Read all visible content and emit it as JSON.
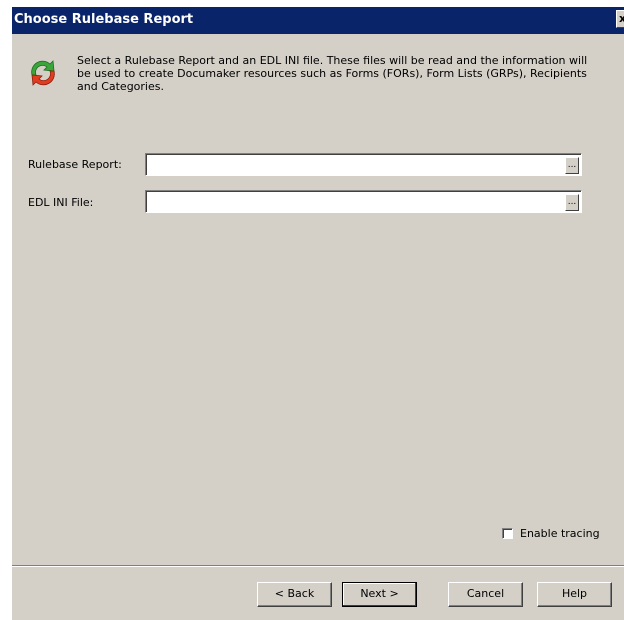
{
  "window": {
    "title": "Choose Rulebase Report",
    "close_glyph": "x"
  },
  "header": {
    "icon": "refresh-arrows-icon",
    "description": "Select a Rulebase Report and an EDL INI file. These files will be read and the information will be used to create Documaker resources such as Forms (FORs), Form Lists (GRPs), Recipients and Categories."
  },
  "fields": {
    "rulebase_report": {
      "label": "Rulebase Report:",
      "value": "",
      "browse_label": "..."
    },
    "edl_ini_file": {
      "label": "EDL INI File:",
      "value": "",
      "browse_label": "..."
    }
  },
  "options": {
    "enable_tracing": {
      "label": "Enable tracing",
      "checked": false
    }
  },
  "buttons": {
    "back": "< Back",
    "next": "Next >",
    "cancel": "Cancel",
    "help": "Help"
  },
  "colors": {
    "titlebar": "#0a246a",
    "dialog_bg": "#d4d0c8",
    "arrow_green": "#3aa53a",
    "arrow_red": "#e03c1f"
  }
}
